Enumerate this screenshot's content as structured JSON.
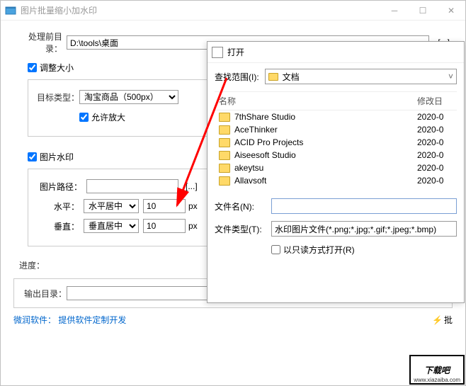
{
  "window": {
    "title": "图片批量缩小加水印"
  },
  "labels": {
    "source_dir": "处理前目录：",
    "resize": "调整大小",
    "target_type": "目标类型：",
    "allow_enlarge": "允许放大",
    "watermark": "图片水印",
    "image_path": "图片路径：",
    "horizontal": "水平：",
    "vertical": "垂直：",
    "px": "px",
    "progress": "进度：",
    "output_dir": "输出目录：",
    "browse": "[...]",
    "link_prefix": "微润软件：",
    "link_text": "提供软件定制开发",
    "batch": "批"
  },
  "values": {
    "source_dir": "D:\\tools\\桌面",
    "target_type": "淘宝商品（500px）",
    "h_align": "水平居中",
    "v_align": "垂直居中",
    "h_offset": "10",
    "v_offset": "10",
    "output_dir": ""
  },
  "checks": {
    "resize": true,
    "allow_enlarge": true,
    "watermark": true
  },
  "dialog": {
    "title": "打开",
    "lookin_label": "查找范围(I):",
    "lookin_value": "文档",
    "col_name": "名称",
    "col_date": "修改日",
    "files": [
      {
        "name": "7thShare Studio",
        "date": "2020-0"
      },
      {
        "name": "AceThinker",
        "date": "2020-0"
      },
      {
        "name": "ACID Pro Projects",
        "date": "2020-0"
      },
      {
        "name": "Aiseesoft Studio",
        "date": "2020-0"
      },
      {
        "name": "akeytsu",
        "date": "2020-0"
      },
      {
        "name": "Allavsoft",
        "date": "2020-0"
      }
    ],
    "filename_label": "文件名(N):",
    "filetype_label": "文件类型(T):",
    "filetype_value": "水印图片文件(*.png;*.jpg;*.gif;*.jpeg;*.bmp)",
    "readonly_label": "以只读方式打开(R)"
  },
  "corner": {
    "logo": "下载吧",
    "sub": "www.xiazaiba.com"
  }
}
